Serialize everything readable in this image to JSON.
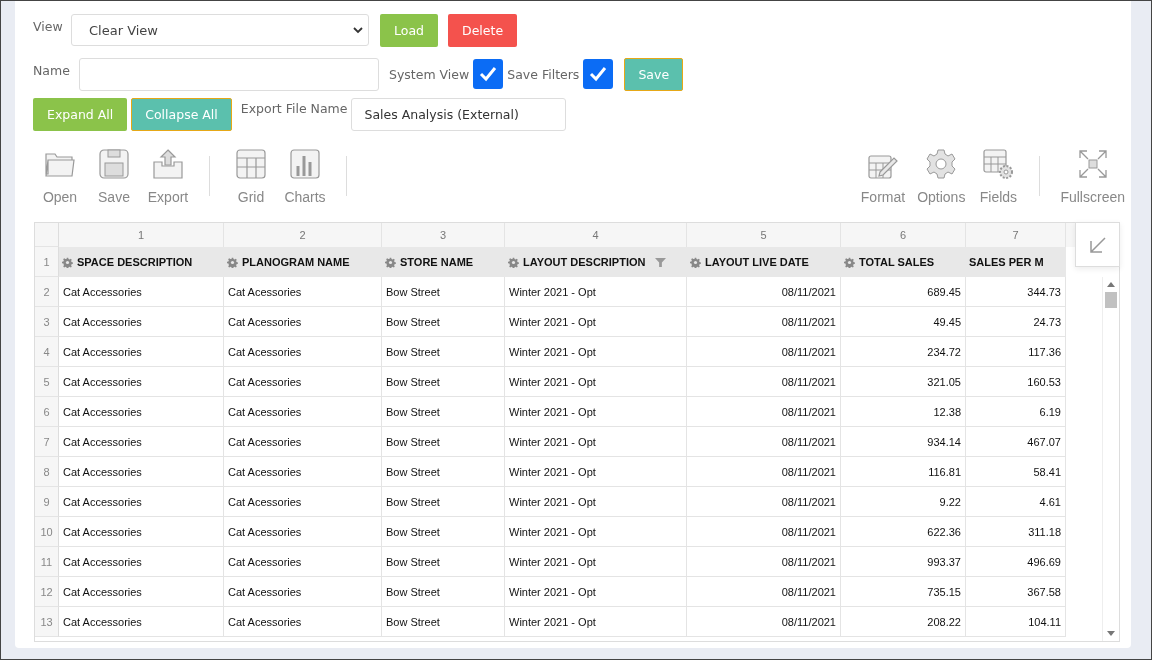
{
  "view": {
    "label": "View",
    "value": "Clear View"
  },
  "view_buttons": [
    {
      "label": "Load",
      "kind": "green"
    },
    {
      "label": "Delete",
      "kind": "red"
    }
  ],
  "name_field": {
    "label": "Name"
  },
  "checks": [
    {
      "label": "System View",
      "checked": true
    },
    {
      "label": "Save Filters",
      "checked": true
    }
  ],
  "save_button": {
    "label": "Save"
  },
  "tree_buttons": [
    {
      "label": "Expand All",
      "kind": "green"
    },
    {
      "label": "Collapse All",
      "kind": "teal"
    }
  ],
  "export_name": {
    "label": "Export File Name",
    "value": "Sales Analysis (External)"
  },
  "toolbar": {
    "left_groups": [
      [
        {
          "label": "Open",
          "kind": "folder"
        },
        {
          "label": "Save",
          "kind": "floppy"
        },
        {
          "label": "Export",
          "kind": "upload"
        }
      ],
      [
        {
          "label": "Grid",
          "kind": "grid"
        },
        {
          "label": "Charts",
          "kind": "bars"
        }
      ]
    ],
    "right_groups": [
      [
        {
          "label": "Format",
          "kind": "edit-grid"
        },
        {
          "label": "Options",
          "kind": "gear"
        },
        {
          "label": "Fields",
          "kind": "grid-gear"
        }
      ],
      [
        {
          "label": "Fullscreen",
          "kind": "expand"
        }
      ]
    ]
  },
  "table": {
    "corner_row": "1",
    "columns": [
      {
        "number": "1",
        "title": "SPACE DESCRIPTION",
        "settings": true,
        "filtered": false
      },
      {
        "number": "2",
        "title": "PLANOGRAM NAME",
        "settings": true,
        "filtered": false
      },
      {
        "number": "3",
        "title": "STORE NAME",
        "settings": true,
        "filtered": false
      },
      {
        "number": "4",
        "title": "LAYOUT DESCRIPTION",
        "settings": true,
        "filtered": true
      },
      {
        "number": "5",
        "title": "LAYOUT LIVE DATE",
        "settings": true,
        "filtered": false
      },
      {
        "number": "6",
        "title": "TOTAL SALES",
        "settings": true,
        "filtered": false
      },
      {
        "number": "7",
        "title": "SALES PER M",
        "settings": false,
        "filtered": false
      }
    ],
    "rows": [
      {
        "n": "2",
        "cells": [
          "Cat Accessories",
          "Cat Acessories",
          "Bow Street",
          "Winter 2021 - Opt",
          "08/11/2021",
          "689.45",
          "344.73"
        ]
      },
      {
        "n": "3",
        "cells": [
          "Cat Accessories",
          "Cat Acessories",
          "Bow Street",
          "Winter 2021 - Opt",
          "08/11/2021",
          "49.45",
          "24.73"
        ]
      },
      {
        "n": "4",
        "cells": [
          "Cat Accessories",
          "Cat Acessories",
          "Bow Street",
          "Winter 2021 - Opt",
          "08/11/2021",
          "234.72",
          "117.36"
        ]
      },
      {
        "n": "5",
        "cells": [
          "Cat Accessories",
          "Cat Acessories",
          "Bow Street",
          "Winter 2021 - Opt",
          "08/11/2021",
          "321.05",
          "160.53"
        ]
      },
      {
        "n": "6",
        "cells": [
          "Cat Accessories",
          "Cat Acessories",
          "Bow Street",
          "Winter 2021 - Opt",
          "08/11/2021",
          "12.38",
          "6.19"
        ]
      },
      {
        "n": "7",
        "cells": [
          "Cat Accessories",
          "Cat Acessories",
          "Bow Street",
          "Winter 2021 - Opt",
          "08/11/2021",
          "934.14",
          "467.07"
        ]
      },
      {
        "n": "8",
        "cells": [
          "Cat Accessories",
          "Cat Acessories",
          "Bow Street",
          "Winter 2021 - Opt",
          "08/11/2021",
          "116.81",
          "58.41"
        ]
      },
      {
        "n": "9",
        "cells": [
          "Cat Accessories",
          "Cat Acessories",
          "Bow Street",
          "Winter 2021 - Opt",
          "08/11/2021",
          "9.22",
          "4.61"
        ]
      },
      {
        "n": "10",
        "cells": [
          "Cat Accessories",
          "Cat Acessories",
          "Bow Street",
          "Winter 2021 - Opt",
          "08/11/2021",
          "622.36",
          "311.18"
        ]
      },
      {
        "n": "11",
        "cells": [
          "Cat Accessories",
          "Cat Acessories",
          "Bow Street",
          "Winter 2021 - Opt",
          "08/11/2021",
          "993.37",
          "496.69"
        ]
      },
      {
        "n": "12",
        "cells": [
          "Cat Accessories",
          "Cat Acessories",
          "Bow Street",
          "Winter 2021 - Opt",
          "08/11/2021",
          "735.15",
          "367.58"
        ]
      },
      {
        "n": "13",
        "cells": [
          "Cat Accessories",
          "Cat Acessories",
          "Bow Street",
          "Winter 2021 - Opt",
          "08/11/2021",
          "208.22",
          "104.11"
        ]
      }
    ]
  }
}
